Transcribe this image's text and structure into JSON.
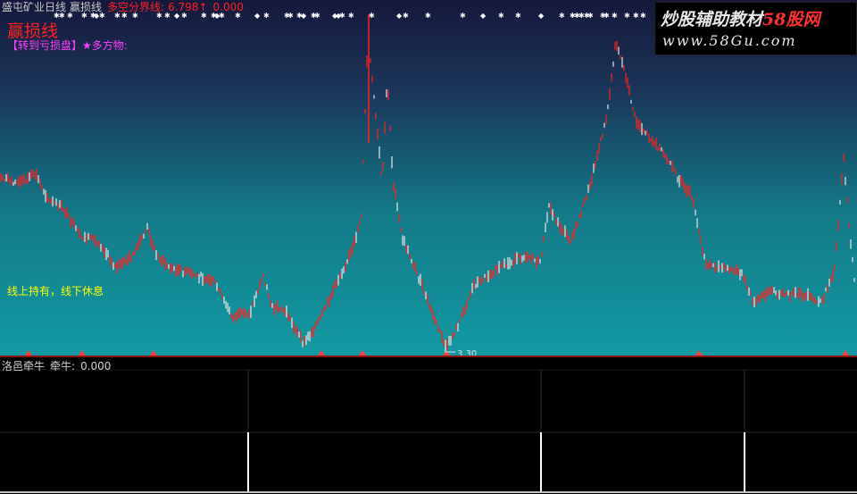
{
  "header": {
    "stock_name": "盛屯矿业日线",
    "indicator_name": "赢损线",
    "boundary_label": "多空分界线:",
    "boundary_value": "6.798",
    "boundary_arrow": "↑",
    "boundary_zero": "0.000"
  },
  "main": {
    "big_title": "赢损线",
    "status_text": "【转到亏损盘】★多方物:",
    "hold_note": "线上持有，线下休息",
    "low_price_label": "3.30"
  },
  "sub": {
    "indicator_group": "洛邑牵牛",
    "indicator_name": "牵牛:",
    "indicator_value": "0.000"
  },
  "watermark": {
    "line1_text": "炒股辅助教材",
    "line1_brand": "58股网",
    "line2_text": "www.58Gu.com"
  },
  "colors": {
    "up_candle": "#ff2020",
    "down_candle": "#e8e8e8",
    "buy_marker": "#ff4040",
    "sub_line": "#ffffff"
  }
}
